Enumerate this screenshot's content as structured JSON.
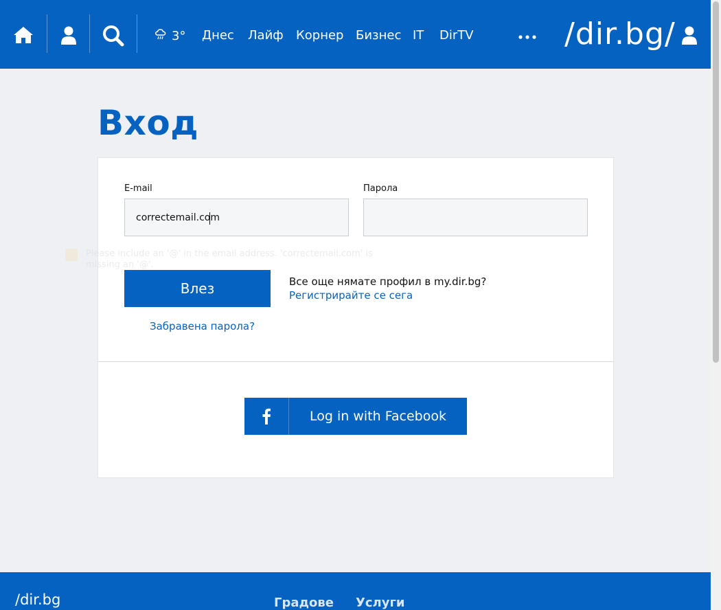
{
  "header": {
    "weather_temp": "3°",
    "nav": [
      {
        "label": "Днес"
      },
      {
        "label": "Лайф"
      },
      {
        "label": "Корнер"
      },
      {
        "label": "Бизнес"
      },
      {
        "label": "IT"
      },
      {
        "label": "DirTV"
      }
    ],
    "more_label": "···",
    "logo_text": "/dir.bg/",
    "icons": [
      "home-icon",
      "user-icon",
      "search-icon",
      "weather-icon",
      "more-icon",
      "account-icon"
    ],
    "bg_color": "#0662c1"
  },
  "page": {
    "title": "Вход"
  },
  "form": {
    "email_label": "E-mail",
    "email_value": "correctemail.com",
    "password_label": "Парола",
    "password_value": "",
    "validation_tooltip": "Please include an '@' in the email address. 'correctemail.com' is missing an '@'.",
    "login_button": "Влез",
    "no_account_text": "Все още нямате профил в my.dir.bg?",
    "register_link": "Регистрирайте се сега",
    "forgot_password": "Забравена парола?",
    "facebook_button": "Log in with Facebook"
  },
  "footer": {
    "logo_text": "/dir.bg",
    "links": [
      {
        "label": "Градове"
      },
      {
        "label": "Услуги"
      }
    ]
  },
  "colors": {
    "accent": "#0662c1",
    "background": "#eef0f4"
  }
}
